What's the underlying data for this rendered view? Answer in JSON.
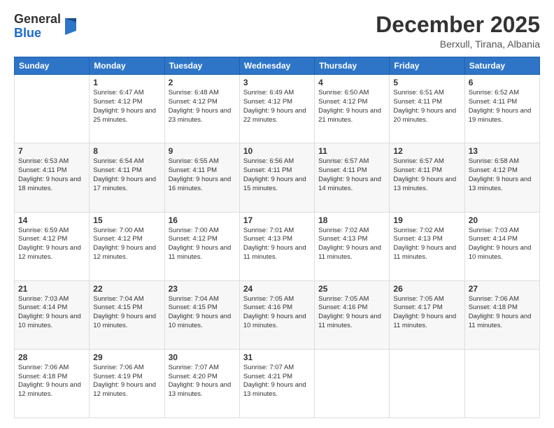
{
  "header": {
    "logo_line1": "General",
    "logo_line2": "Blue",
    "month_title": "December 2025",
    "subtitle": "Berxull, Tirana, Albania"
  },
  "days_of_week": [
    "Sunday",
    "Monday",
    "Tuesday",
    "Wednesday",
    "Thursday",
    "Friday",
    "Saturday"
  ],
  "weeks": [
    [
      {
        "day": "",
        "sunrise": "",
        "sunset": "",
        "daylight": ""
      },
      {
        "day": "1",
        "sunrise": "Sunrise: 6:47 AM",
        "sunset": "Sunset: 4:12 PM",
        "daylight": "Daylight: 9 hours and 25 minutes."
      },
      {
        "day": "2",
        "sunrise": "Sunrise: 6:48 AM",
        "sunset": "Sunset: 4:12 PM",
        "daylight": "Daylight: 9 hours and 23 minutes."
      },
      {
        "day": "3",
        "sunrise": "Sunrise: 6:49 AM",
        "sunset": "Sunset: 4:12 PM",
        "daylight": "Daylight: 9 hours and 22 minutes."
      },
      {
        "day": "4",
        "sunrise": "Sunrise: 6:50 AM",
        "sunset": "Sunset: 4:12 PM",
        "daylight": "Daylight: 9 hours and 21 minutes."
      },
      {
        "day": "5",
        "sunrise": "Sunrise: 6:51 AM",
        "sunset": "Sunset: 4:11 PM",
        "daylight": "Daylight: 9 hours and 20 minutes."
      },
      {
        "day": "6",
        "sunrise": "Sunrise: 6:52 AM",
        "sunset": "Sunset: 4:11 PM",
        "daylight": "Daylight: 9 hours and 19 minutes."
      }
    ],
    [
      {
        "day": "7",
        "sunrise": "Sunrise: 6:53 AM",
        "sunset": "Sunset: 4:11 PM",
        "daylight": "Daylight: 9 hours and 18 minutes."
      },
      {
        "day": "8",
        "sunrise": "Sunrise: 6:54 AM",
        "sunset": "Sunset: 4:11 PM",
        "daylight": "Daylight: 9 hours and 17 minutes."
      },
      {
        "day": "9",
        "sunrise": "Sunrise: 6:55 AM",
        "sunset": "Sunset: 4:11 PM",
        "daylight": "Daylight: 9 hours and 16 minutes."
      },
      {
        "day": "10",
        "sunrise": "Sunrise: 6:56 AM",
        "sunset": "Sunset: 4:11 PM",
        "daylight": "Daylight: 9 hours and 15 minutes."
      },
      {
        "day": "11",
        "sunrise": "Sunrise: 6:57 AM",
        "sunset": "Sunset: 4:11 PM",
        "daylight": "Daylight: 9 hours and 14 minutes."
      },
      {
        "day": "12",
        "sunrise": "Sunrise: 6:57 AM",
        "sunset": "Sunset: 4:11 PM",
        "daylight": "Daylight: 9 hours and 13 minutes."
      },
      {
        "day": "13",
        "sunrise": "Sunrise: 6:58 AM",
        "sunset": "Sunset: 4:12 PM",
        "daylight": "Daylight: 9 hours and 13 minutes."
      }
    ],
    [
      {
        "day": "14",
        "sunrise": "Sunrise: 6:59 AM",
        "sunset": "Sunset: 4:12 PM",
        "daylight": "Daylight: 9 hours and 12 minutes."
      },
      {
        "day": "15",
        "sunrise": "Sunrise: 7:00 AM",
        "sunset": "Sunset: 4:12 PM",
        "daylight": "Daylight: 9 hours and 12 minutes."
      },
      {
        "day": "16",
        "sunrise": "Sunrise: 7:00 AM",
        "sunset": "Sunset: 4:12 PM",
        "daylight": "Daylight: 9 hours and 11 minutes."
      },
      {
        "day": "17",
        "sunrise": "Sunrise: 7:01 AM",
        "sunset": "Sunset: 4:13 PM",
        "daylight": "Daylight: 9 hours and 11 minutes."
      },
      {
        "day": "18",
        "sunrise": "Sunrise: 7:02 AM",
        "sunset": "Sunset: 4:13 PM",
        "daylight": "Daylight: 9 hours and 11 minutes."
      },
      {
        "day": "19",
        "sunrise": "Sunrise: 7:02 AM",
        "sunset": "Sunset: 4:13 PM",
        "daylight": "Daylight: 9 hours and 11 minutes."
      },
      {
        "day": "20",
        "sunrise": "Sunrise: 7:03 AM",
        "sunset": "Sunset: 4:14 PM",
        "daylight": "Daylight: 9 hours and 10 minutes."
      }
    ],
    [
      {
        "day": "21",
        "sunrise": "Sunrise: 7:03 AM",
        "sunset": "Sunset: 4:14 PM",
        "daylight": "Daylight: 9 hours and 10 minutes."
      },
      {
        "day": "22",
        "sunrise": "Sunrise: 7:04 AM",
        "sunset": "Sunset: 4:15 PM",
        "daylight": "Daylight: 9 hours and 10 minutes."
      },
      {
        "day": "23",
        "sunrise": "Sunrise: 7:04 AM",
        "sunset": "Sunset: 4:15 PM",
        "daylight": "Daylight: 9 hours and 10 minutes."
      },
      {
        "day": "24",
        "sunrise": "Sunrise: 7:05 AM",
        "sunset": "Sunset: 4:16 PM",
        "daylight": "Daylight: 9 hours and 10 minutes."
      },
      {
        "day": "25",
        "sunrise": "Sunrise: 7:05 AM",
        "sunset": "Sunset: 4:16 PM",
        "daylight": "Daylight: 9 hours and 11 minutes."
      },
      {
        "day": "26",
        "sunrise": "Sunrise: 7:05 AM",
        "sunset": "Sunset: 4:17 PM",
        "daylight": "Daylight: 9 hours and 11 minutes."
      },
      {
        "day": "27",
        "sunrise": "Sunrise: 7:06 AM",
        "sunset": "Sunset: 4:18 PM",
        "daylight": "Daylight: 9 hours and 11 minutes."
      }
    ],
    [
      {
        "day": "28",
        "sunrise": "Sunrise: 7:06 AM",
        "sunset": "Sunset: 4:18 PM",
        "daylight": "Daylight: 9 hours and 12 minutes."
      },
      {
        "day": "29",
        "sunrise": "Sunrise: 7:06 AM",
        "sunset": "Sunset: 4:19 PM",
        "daylight": "Daylight: 9 hours and 12 minutes."
      },
      {
        "day": "30",
        "sunrise": "Sunrise: 7:07 AM",
        "sunset": "Sunset: 4:20 PM",
        "daylight": "Daylight: 9 hours and 13 minutes."
      },
      {
        "day": "31",
        "sunrise": "Sunrise: 7:07 AM",
        "sunset": "Sunset: 4:21 PM",
        "daylight": "Daylight: 9 hours and 13 minutes."
      },
      {
        "day": "",
        "sunrise": "",
        "sunset": "",
        "daylight": ""
      },
      {
        "day": "",
        "sunrise": "",
        "sunset": "",
        "daylight": ""
      },
      {
        "day": "",
        "sunrise": "",
        "sunset": "",
        "daylight": ""
      }
    ]
  ]
}
